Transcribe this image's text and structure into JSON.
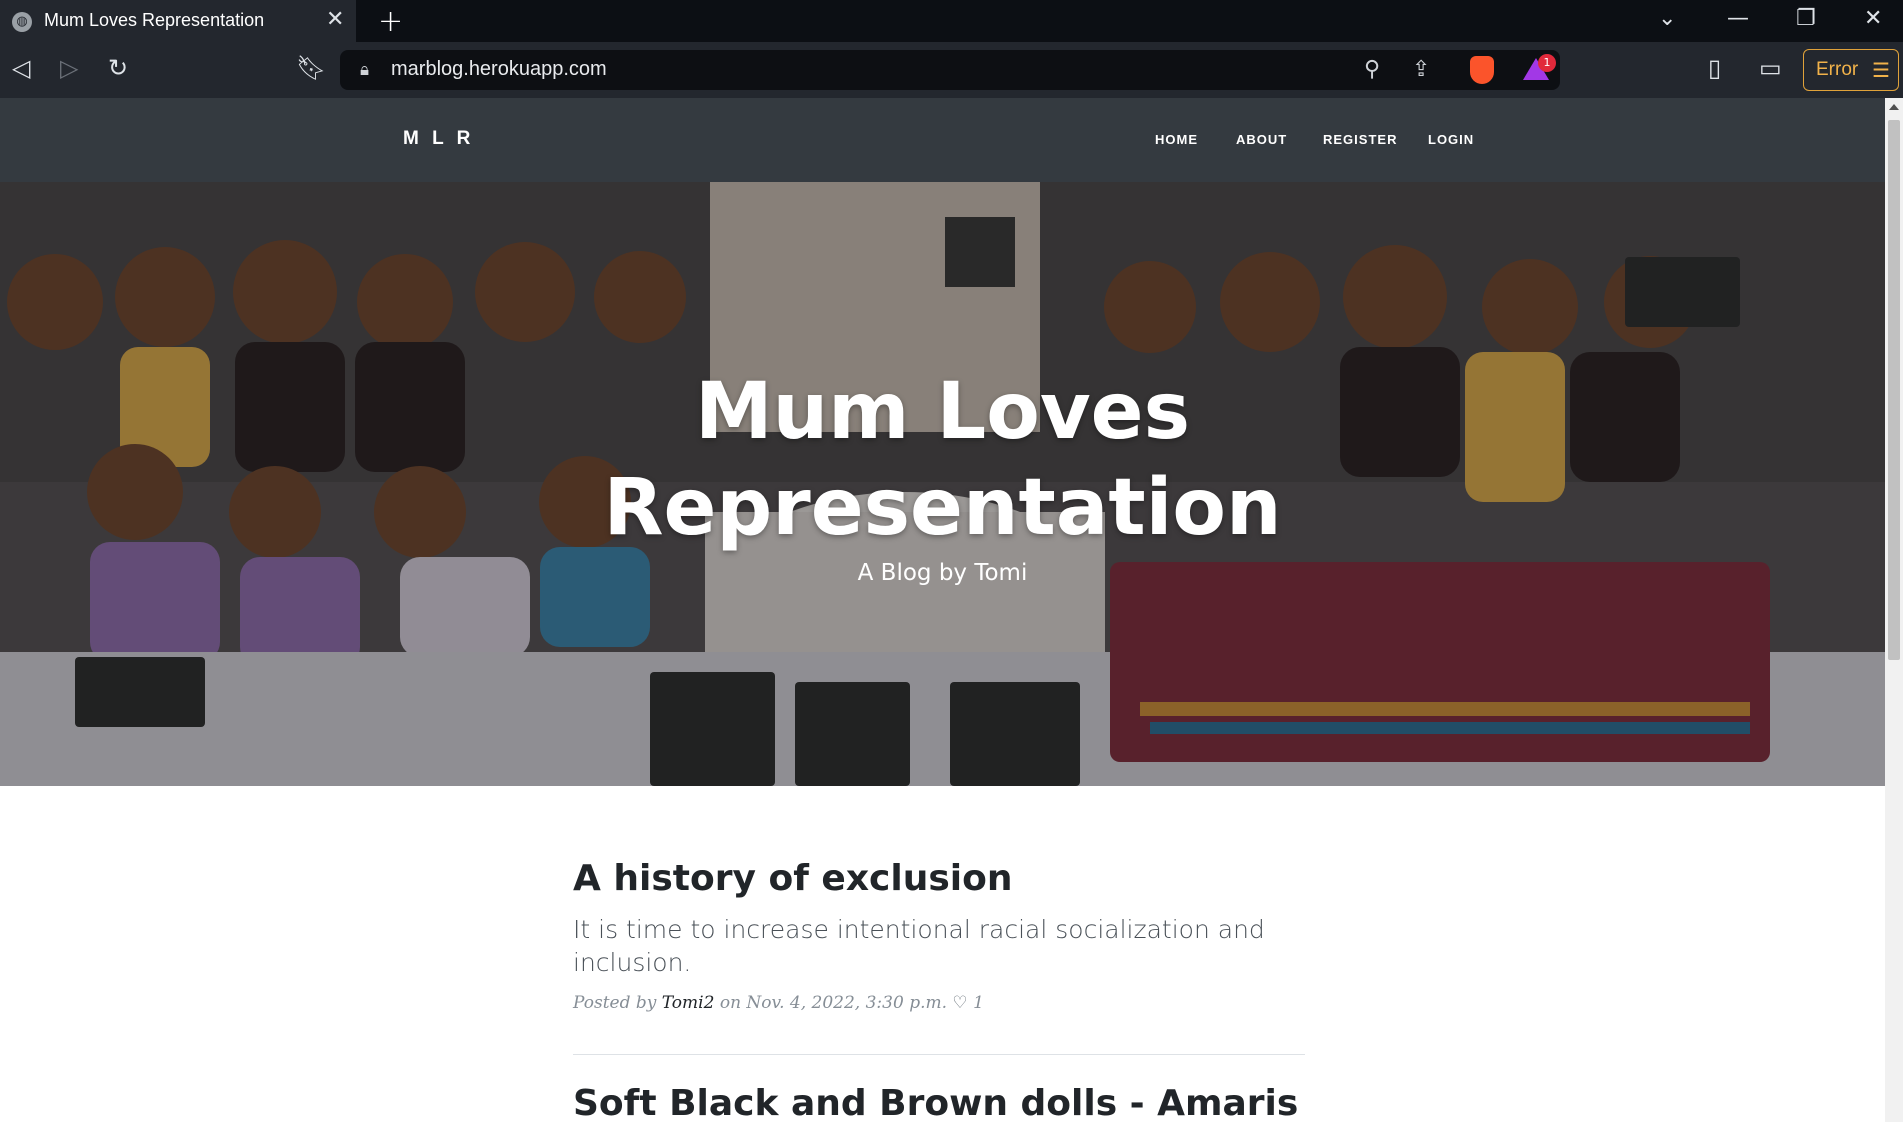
{
  "browser": {
    "tab_title": "Mum Loves Representation",
    "url": "marblog.herokuapp.com",
    "error_label": "Error",
    "bat_badge": "1",
    "icons": [
      "globe-icon",
      "close-icon",
      "plus-icon",
      "back-icon",
      "forward-icon",
      "reload-icon",
      "bookmark-icon",
      "lock-icon",
      "zoom-icon",
      "share-icon",
      "brave-shield-icon",
      "bat-rewards-icon",
      "sidebar-icon",
      "wallet-icon",
      "menu-icon"
    ]
  },
  "navbar": {
    "brand": "M L R",
    "links": [
      "HOME",
      "ABOUT",
      "REGISTER",
      "LOGIN"
    ]
  },
  "hero": {
    "title_line1": "Mum Loves",
    "title_line2": "Representation",
    "subtitle": "A Blog by Tomi"
  },
  "posts": [
    {
      "title": "A history of exclusion",
      "subtitle": "It is time to increase intentional racial socialization and inclusion.",
      "posted_by": "Posted by",
      "author": "Tomi2",
      "date_text": "on Nov. 4, 2022, 3:30 p.m.",
      "likes": "1"
    },
    {
      "title": "Soft Black and Brown dolls - Amaris"
    }
  ],
  "colors": {
    "navbar": "#343a40",
    "chrome": "#23272e",
    "error_accent": "#f1b24a"
  }
}
